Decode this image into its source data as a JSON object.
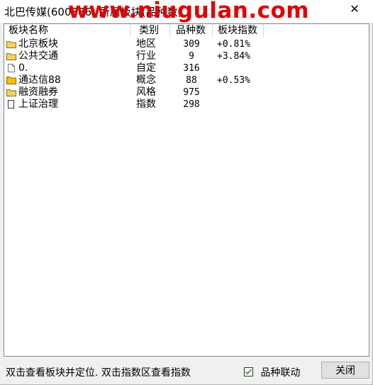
{
  "window": {
    "title": "北巴传媒(600386) 所属板块(品种数)",
    "watermark": "www.niugulan.com",
    "close_glyph": "✕"
  },
  "list": {
    "columns": {
      "name": "板块名称",
      "type": "类别",
      "count": "品种数",
      "index": "板块指数"
    },
    "rows": [
      {
        "icon": "folder-icon",
        "name": "北京板块",
        "type": "地区",
        "count": "309",
        "index": "+0.81%"
      },
      {
        "icon": "folder-icon",
        "name": "公共交通",
        "type": "行业",
        "count": "9",
        "index": "+3.84%"
      },
      {
        "icon": "document-icon",
        "name": "0.",
        "type": "自定",
        "count": "316",
        "index": ""
      },
      {
        "icon": "folder-yellow-icon",
        "name": "通达信88",
        "type": "概念",
        "count": "88",
        "index": "+0.53%"
      },
      {
        "icon": "folder-icon",
        "name": "融资融券",
        "type": "风格",
        "count": "975",
        "index": ""
      },
      {
        "icon": "page-icon",
        "name": "上证治理",
        "type": "指数",
        "count": "298",
        "index": ""
      }
    ]
  },
  "footer": {
    "hint": "双击查看板块并定位. 双击指数区查看指数",
    "checkbox_label": "品种联动",
    "checkbox_checked": true,
    "close_label": "关闭"
  },
  "colors": {
    "watermark": "#e40000",
    "folder": "#f5d35a",
    "folder_yellow": "#f2c200",
    "check": "#2a8a2a"
  }
}
